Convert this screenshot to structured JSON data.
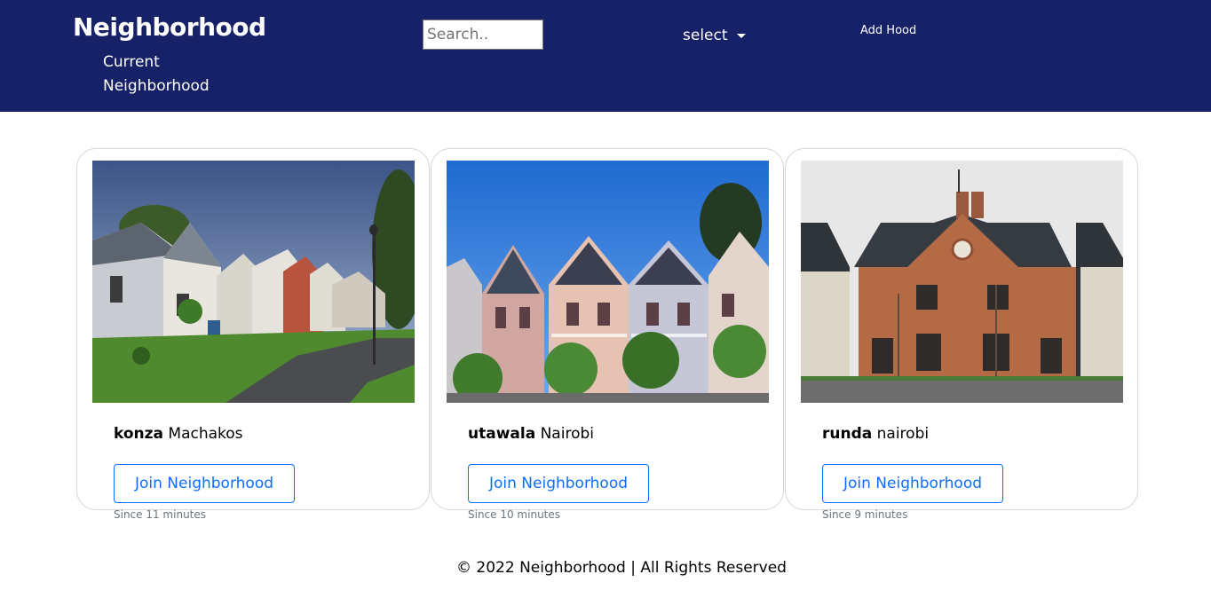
{
  "navbar": {
    "brand": "Neighborhood",
    "current_link": "Current Neighborhood",
    "search_placeholder": "Search..",
    "select_label": "select",
    "add_hood": "Add Hood"
  },
  "cards": [
    {
      "name": "konza",
      "location": "Machakos",
      "button": "Join Neighborhood",
      "since": "Since 11 minutes",
      "image": "suburban-street-houses"
    },
    {
      "name": "utawala",
      "location": "Nairobi",
      "button": "Join Neighborhood",
      "since": "Since 10 minutes",
      "image": "victorian-row-houses"
    },
    {
      "name": "runda",
      "location": "nairobi",
      "button": "Join Neighborhood",
      "since": "Since 9 minutes",
      "image": "brick-house"
    }
  ],
  "footer": {
    "text": "© 2022 Neighborhood | All Rights Reserved"
  },
  "colors": {
    "navbar": "#162168",
    "button": "#0d6efd",
    "muted": "#6c757d"
  }
}
